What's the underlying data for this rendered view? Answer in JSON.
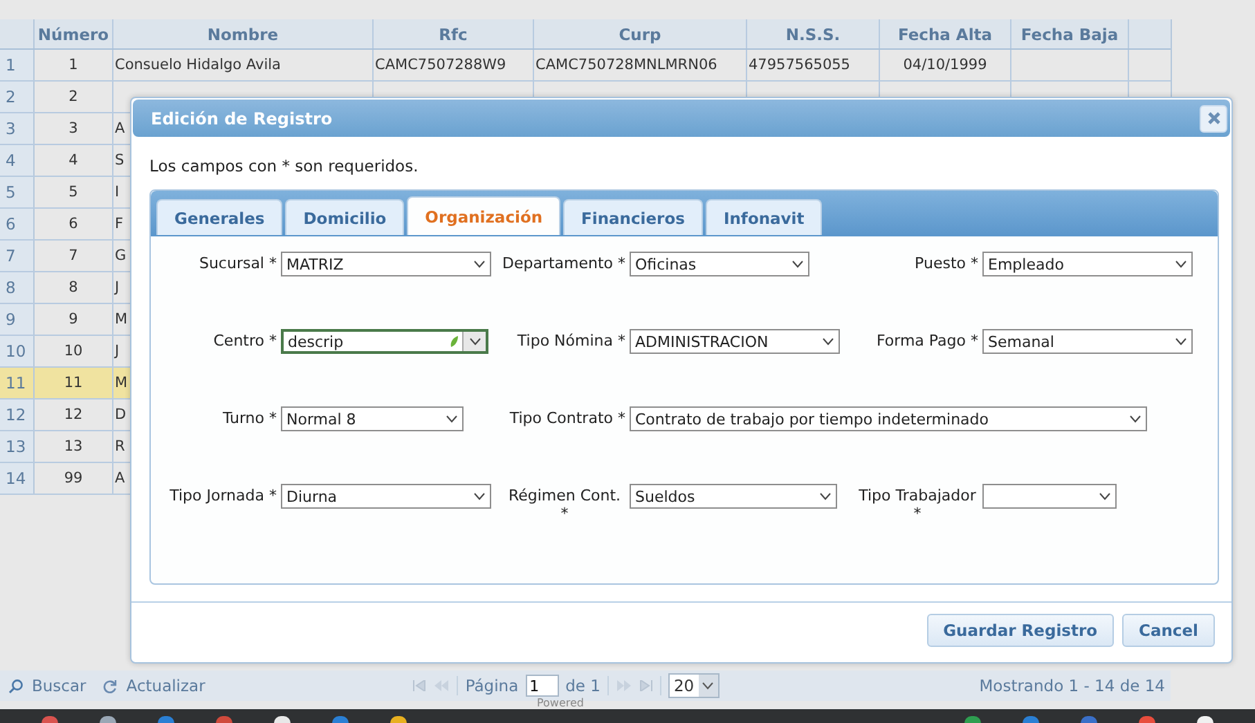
{
  "grid": {
    "columns": [
      "Número",
      "Nombre",
      "Rfc",
      "Curp",
      "N.S.S.",
      "Fecha Alta",
      "Fecha Baja"
    ],
    "rows": [
      {
        "n": "1",
        "cells": [
          "1",
          "Consuelo Hidalgo Avila",
          "CAMC7507288W9",
          "CAMC750728MNLMRN06",
          "47957565055",
          "04/10/1999",
          ""
        ],
        "selected": false
      },
      {
        "n": "2",
        "cells": [
          "2",
          "",
          "",
          "",
          "",
          "",
          ""
        ],
        "selected": false
      },
      {
        "n": "3",
        "cells": [
          "3",
          "A",
          "",
          "",
          "",
          "",
          ""
        ],
        "selected": false
      },
      {
        "n": "4",
        "cells": [
          "4",
          "S",
          "",
          "",
          "",
          "",
          ""
        ],
        "selected": false
      },
      {
        "n": "5",
        "cells": [
          "5",
          "I",
          "",
          "",
          "",
          "",
          ""
        ],
        "selected": false
      },
      {
        "n": "6",
        "cells": [
          "6",
          "F",
          "",
          "",
          "",
          "",
          ""
        ],
        "selected": false
      },
      {
        "n": "7",
        "cells": [
          "7",
          "G",
          "",
          "",
          "",
          "",
          ""
        ],
        "selected": false
      },
      {
        "n": "8",
        "cells": [
          "8",
          "J",
          "",
          "",
          "",
          "",
          ""
        ],
        "selected": false
      },
      {
        "n": "9",
        "cells": [
          "9",
          "M",
          "",
          "",
          "",
          "",
          ""
        ],
        "selected": false
      },
      {
        "n": "10",
        "cells": [
          "10",
          "J",
          "",
          "",
          "",
          "",
          ""
        ],
        "selected": false
      },
      {
        "n": "11",
        "cells": [
          "11",
          "M",
          "",
          "",
          "",
          "",
          ""
        ],
        "selected": true
      },
      {
        "n": "12",
        "cells": [
          "12",
          "D",
          "",
          "",
          "",
          "",
          ""
        ],
        "selected": false
      },
      {
        "n": "13",
        "cells": [
          "13",
          "R",
          "",
          "",
          "",
          "",
          ""
        ],
        "selected": false
      },
      {
        "n": "14",
        "cells": [
          "99",
          "A",
          "",
          "",
          "",
          "",
          ""
        ],
        "selected": false
      }
    ]
  },
  "toolbar": {
    "search": "Buscar",
    "refresh": "Actualizar",
    "page_label": "Página",
    "page": "1",
    "page_of": "de 1",
    "page_size": "20",
    "summary": "Mostrando 1 - 14 de 14",
    "powered": "Powered"
  },
  "dialog": {
    "title": "Edición de Registro",
    "note": "Los campos con * son requeridos.",
    "tabs": [
      {
        "label": "Generales",
        "selected": false
      },
      {
        "label": "Domicilio",
        "selected": false
      },
      {
        "label": "Organización",
        "selected": true
      },
      {
        "label": "Financieros",
        "selected": false
      },
      {
        "label": "Infonavit",
        "selected": false
      }
    ],
    "rows": [
      [
        {
          "label": "Sucursal *",
          "value": "MATRIZ",
          "focused": false
        },
        {
          "label": "Departamento *",
          "value": "Oficinas",
          "focused": false
        },
        {
          "label": "Puesto *",
          "value": "Empleado",
          "focused": false
        }
      ],
      [
        {
          "label": "Centro *",
          "value": "descrip",
          "focused": true
        },
        {
          "label": "Tipo Nómina *",
          "value": "ADMINISTRACION",
          "focused": false
        },
        {
          "label": "Forma Pago *",
          "value": "Semanal",
          "focused": false
        }
      ],
      [
        {
          "label": "Turno *",
          "value": "Normal 8",
          "focused": false
        },
        {
          "label": "Tipo Contrato *",
          "value": "Contrato de trabajo por tiempo indeterminado",
          "focused": false
        }
      ],
      [
        {
          "label": "Tipo Jornada *",
          "value": "Diurna",
          "focused": false
        },
        {
          "label": "Régimen Cont. *",
          "value": "Sueldos",
          "focused": false
        },
        {
          "label": "Tipo Trabajador *",
          "focused": false
        }
      ]
    ],
    "buttons": [
      "Guardar Registro",
      "Cancel"
    ]
  }
}
